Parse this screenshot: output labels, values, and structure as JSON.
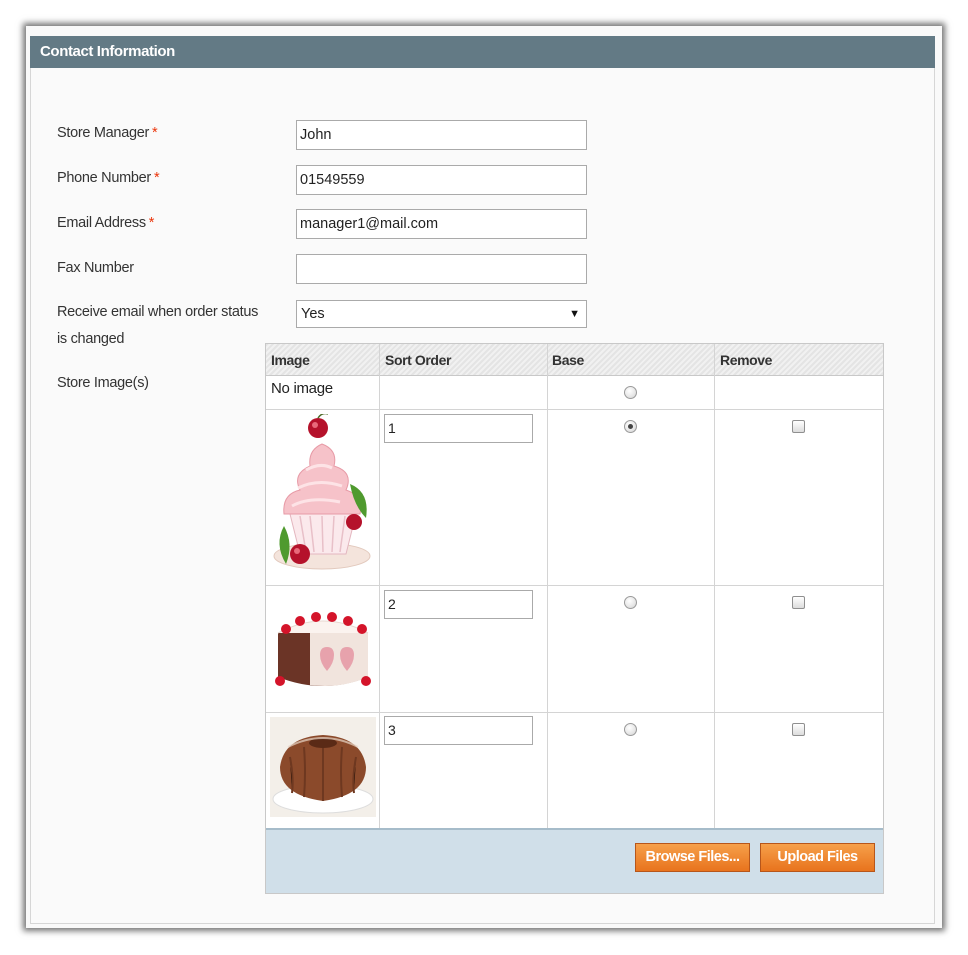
{
  "section": {
    "title": "Contact Information"
  },
  "form": {
    "store_manager": {
      "label": "Store Manager",
      "required": "*",
      "value": "John"
    },
    "phone_number": {
      "label": "Phone Number",
      "required": "*",
      "value": "01549559"
    },
    "email_address": {
      "label": "Email Address",
      "required": "*",
      "value": "manager1@mail.com"
    },
    "fax_number": {
      "label": "Fax Number",
      "value": ""
    },
    "receive_email": {
      "label_line1": "Receive email when order status",
      "label_line2": "is changed",
      "value": "Yes"
    },
    "store_images": {
      "label": "Store Image(s)"
    }
  },
  "gallery": {
    "columns": [
      "Image",
      "Sort Order",
      "Base",
      "Remove"
    ],
    "no_image_label": "No image",
    "rows": [
      {
        "image": "cupcake-with-cherries",
        "sort_order": "1",
        "base": true,
        "remove": false
      },
      {
        "image": "heart-cake-slice",
        "sort_order": "2",
        "base": false,
        "remove": false
      },
      {
        "image": "bundt-cake",
        "sort_order": "3",
        "base": false,
        "remove": false
      }
    ],
    "buttons": {
      "browse": "Browse Files...",
      "upload": "Upload Files"
    }
  },
  "colors": {
    "header_bg": "#637a85",
    "required_star": "#eb340a",
    "button_orange": "#ef8a32",
    "footer_bg": "#d0dfe9"
  }
}
